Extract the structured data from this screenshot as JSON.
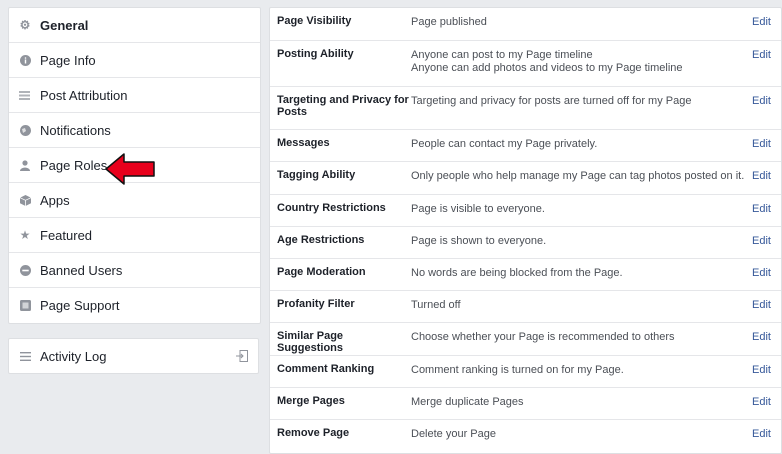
{
  "sidebar": {
    "items": [
      {
        "label": "General",
        "icon": "gear-icon"
      },
      {
        "label": "Page Info",
        "icon": "info-icon"
      },
      {
        "label": "Post Attribution",
        "icon": "flag-icon"
      },
      {
        "label": "Notifications",
        "icon": "globe-icon"
      },
      {
        "label": "Page Roles",
        "icon": "person-icon"
      },
      {
        "label": "Apps",
        "icon": "cube-icon"
      },
      {
        "label": "Featured",
        "icon": "star-icon"
      },
      {
        "label": "Banned Users",
        "icon": "ban-icon"
      },
      {
        "label": "Page Support",
        "icon": "page-icon"
      }
    ],
    "activity_log": "Activity Log"
  },
  "settings": {
    "edit_label": "Edit",
    "rows": [
      {
        "label": "Page Visibility",
        "desc": [
          "Page published"
        ]
      },
      {
        "label": "Posting Ability",
        "desc": [
          "Anyone can post to my Page timeline",
          "Anyone can add photos and videos to my Page timeline"
        ]
      },
      {
        "label": "Targeting and Privacy for Posts",
        "desc": [
          "Targeting and privacy for posts are turned off for my Page"
        ]
      },
      {
        "label": "Messages",
        "desc": [
          "People can contact my Page privately."
        ]
      },
      {
        "label": "Tagging Ability",
        "desc": [
          "Only people who help manage my Page can tag photos posted on it."
        ]
      },
      {
        "label": "Country Restrictions",
        "desc": [
          "Page is visible to everyone."
        ]
      },
      {
        "label": "Age Restrictions",
        "desc": [
          "Page is shown to everyone."
        ]
      },
      {
        "label": "Page Moderation",
        "desc": [
          "No words are being blocked from the Page."
        ]
      },
      {
        "label": "Profanity Filter",
        "desc": [
          "Turned off"
        ]
      },
      {
        "label": "Similar Page Suggestions",
        "desc": [
          "Choose whether your Page is recommended to others"
        ]
      },
      {
        "label": "Comment Ranking",
        "desc": [
          "Comment ranking is turned on for my Page."
        ]
      },
      {
        "label": "Merge Pages",
        "desc": [
          "Merge duplicate Pages"
        ]
      },
      {
        "label": "Remove Page",
        "desc": [
          "Delete your Page"
        ]
      }
    ]
  },
  "colors": {
    "accent": "#365899",
    "arrow": "#e8001c"
  }
}
